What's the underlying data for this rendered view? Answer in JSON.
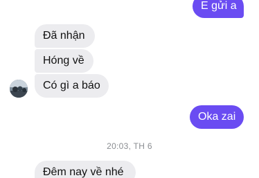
{
  "conversation": {
    "messages": [
      {
        "direction": "outgoing",
        "text": "E gửi a"
      },
      {
        "direction": "incoming",
        "text": "Đã nhận"
      },
      {
        "direction": "incoming",
        "text": "Hóng về"
      },
      {
        "direction": "incoming",
        "text": "Có gì a báo"
      },
      {
        "direction": "outgoing",
        "text": "Oka zai"
      },
      {
        "direction": "incoming",
        "text": "Đêm nay về nhé"
      }
    ],
    "timestamp": "20:03, TH 6"
  },
  "colors": {
    "outgoing_bubble": "#6a4cf2",
    "incoming_bubble": "#ececef",
    "timestamp_text": "#8a8d91"
  },
  "icons": {
    "contact_avatar": "avatar"
  }
}
